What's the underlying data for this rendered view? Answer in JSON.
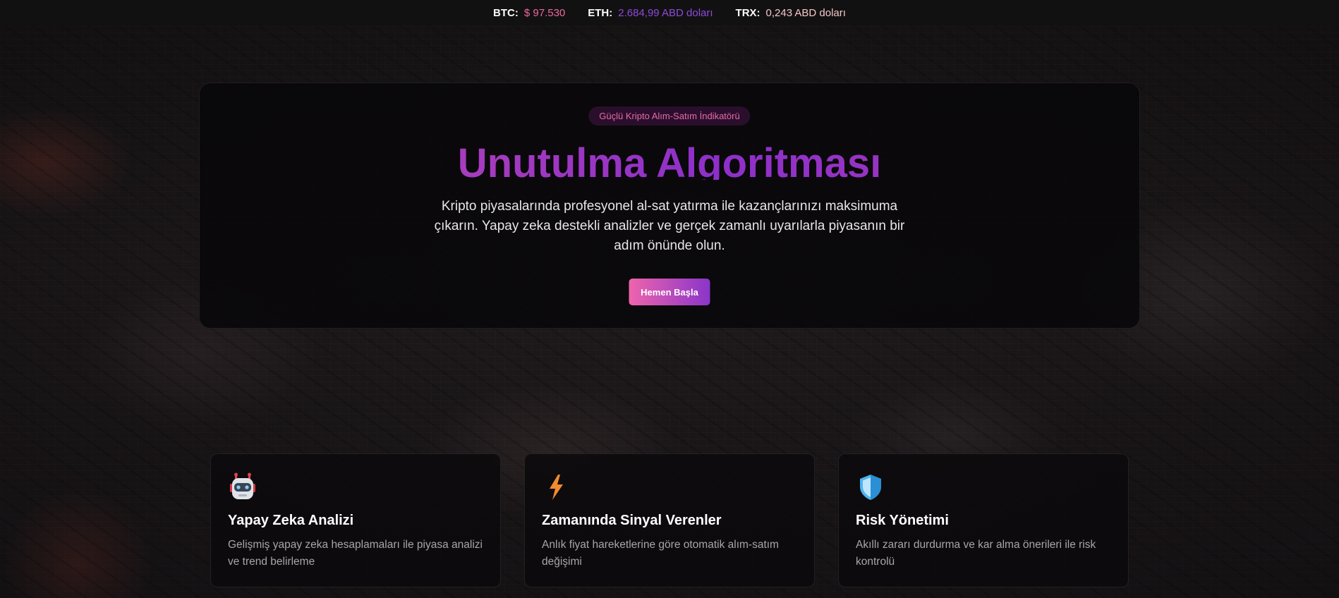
{
  "ticker": [
    {
      "symbol": "BTC:",
      "value": "$ 97.530"
    },
    {
      "symbol": "ETH:",
      "value": "2.684,99 ABD doları"
    },
    {
      "symbol": "TRX:",
      "value": "0,243 ABD doları"
    }
  ],
  "hero": {
    "badge": "Güçlü Kripto Alım-Satım İndikatörü",
    "title": "Unutulma Algoritması",
    "description": "Kripto piyasalarında profesyonel al-sat yatırma ile kazançlarınızı maksimuma çıkarın. Yapay zeka destekli analizler ve gerçek zamanlı uyarılarla piyasanın bir adım önünde olun.",
    "cta_label": "Hemen Başla"
  },
  "features": [
    {
      "icon": "robot-icon",
      "title": "Yapay Zeka Analizi",
      "text": "Gelişmiş yapay zeka hesaplamaları ile piyasa analizi ve trend belirleme"
    },
    {
      "icon": "lightning-icon",
      "title": "Zamanında Sinyal Verenler",
      "text": "Anlık fiyat hareketlerine göre otomatik alım-satım değişimi"
    },
    {
      "icon": "shield-icon",
      "title": "Risk Yönetimi",
      "text": "Akıllı zararı durdurma ve kar alma önerileri ile risk kontrolü"
    }
  ],
  "colors": {
    "accent_pink": "#ee64ad",
    "accent_purple": "#8a35c9",
    "btc_value": "#f0689f",
    "eth_value": "#8c4bd6",
    "trx_value": "#f2c7c7"
  }
}
